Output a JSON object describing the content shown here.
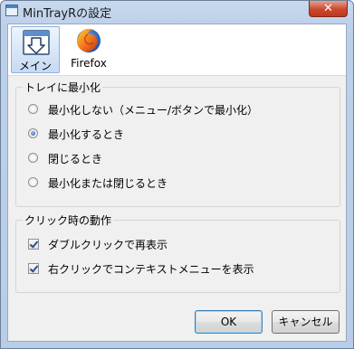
{
  "window": {
    "title": "MinTrayRの設定",
    "close_symbol": "✕"
  },
  "toolbar": {
    "tabs": [
      {
        "label": "メイン",
        "icon": "tray-window-icon",
        "selected": true
      },
      {
        "label": "Firefox",
        "icon": "firefox-icon",
        "selected": false
      }
    ]
  },
  "tray_group": {
    "title": "トレイに最小化",
    "options": [
      {
        "label": "最小化しない（メニュー/ボタンで最小化）",
        "checked": false
      },
      {
        "label": "最小化するとき",
        "checked": true
      },
      {
        "label": "閉じるとき",
        "checked": false
      },
      {
        "label": "最小化または閉じるとき",
        "checked": false
      }
    ]
  },
  "click_group": {
    "title": "クリック時の動作",
    "options": [
      {
        "label": "ダブルクリックで再表示",
        "checked": true
      },
      {
        "label": "右クリックでコンテキストメニューを表示",
        "checked": true
      }
    ]
  },
  "buttons": {
    "ok": "OK",
    "cancel": "キャンセル"
  },
  "colors": {
    "accent": "#3c7fb1",
    "selected_tab": "#c6daf3"
  }
}
